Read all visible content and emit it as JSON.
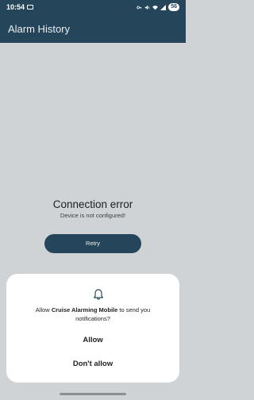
{
  "status_bar": {
    "time": "10:54",
    "battery": "56"
  },
  "app_bar": {
    "title": "Alarm History"
  },
  "error": {
    "title": "Connection error",
    "message": "Device is not configured!",
    "retry_label": "Retry"
  },
  "permission_dialog": {
    "prefix": "Allow ",
    "app_name": "Cruise Alarming Mobile",
    "suffix": " to send you notifications?",
    "allow_label": "Allow",
    "deny_label": "Don't allow"
  },
  "colors": {
    "primary": "#25465a",
    "background": "#cfd3d6",
    "dialog": "#ffffff"
  },
  "icons": {
    "notification": "bell-icon",
    "message": "message-icon",
    "wifi": "wifi-icon",
    "signal": "signal-icon",
    "mute": "mute-icon"
  }
}
